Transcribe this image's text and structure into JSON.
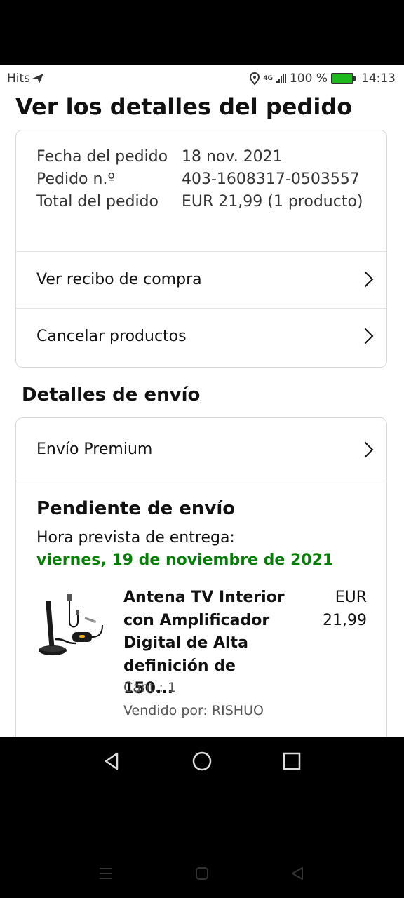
{
  "status_bar": {
    "carrier": "Hits",
    "network": "4G",
    "battery_percent": "100 %",
    "time": "14:13"
  },
  "page_title": "Ver los detalles del pedido",
  "order": {
    "date_label": "Fecha del pedido",
    "date_value": "18 nov. 2021",
    "number_label": "Pedido n.º",
    "number_value": "403-1608317-0503557",
    "total_label": "Total del pedido",
    "total_value": "EUR 21,99 (1 producto)"
  },
  "links": {
    "receipt": "Ver recibo de compra",
    "cancel": "Cancelar productos"
  },
  "shipping": {
    "section_title": "Detalles de envío",
    "method": "Envío Premium",
    "status": "Pendiente de envío",
    "eta_label": "Hora prevista de entrega:",
    "eta_date": "viernes, 19 de noviembre de 2021"
  },
  "product": {
    "name": "Antena TV Interior con Amplificador Digital de Alta definición de 150...",
    "price_currency": "EUR",
    "price_value": "21,99",
    "quantity": "Cant.: 1",
    "seller": "Vendido por: RISHUO"
  },
  "colors": {
    "eta_green": "#067d06",
    "battery_green": "#1fb81f",
    "border": "#d5d9d9"
  },
  "icons": [
    "send-icon",
    "location-icon",
    "signal-icon",
    "battery-icon",
    "chevron-right-icon",
    "nav-back-icon",
    "nav-home-icon",
    "nav-recents-icon"
  ]
}
